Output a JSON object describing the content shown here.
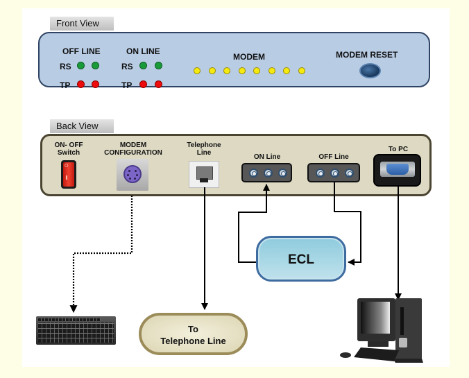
{
  "front_view": {
    "tab_label": "Front View",
    "off_line_label": "OFF LINE",
    "on_line_label": "ON LINE",
    "rs_label": "RS",
    "tp_label": "TP",
    "modem_label": "MODEM",
    "modem_led_count": 8,
    "modem_reset_label": "MODEM RESET",
    "colors": {
      "panel": "#b8cce4",
      "rs_led": "#1a9b3a",
      "tp_led": "#ee0b0b",
      "modem_led": "#f4ea10"
    }
  },
  "back_view": {
    "tab_label": "Back View",
    "switch_label": "ON- OFF\nSwitch",
    "modem_config_label": "MODEM\nCONFIGURATION",
    "telephone_line_label": "Telephone\nLine",
    "on_line_label": "ON Line",
    "off_line_label": "OFF Line",
    "to_pc_label": "To PC",
    "switch_marks": {
      "off": "O",
      "on": "I"
    },
    "colors": {
      "panel": "#ddd9c3"
    }
  },
  "nodes": {
    "ecl_label": "ECL",
    "telephone_terminal_label": "To\nTelephone Line",
    "keyboard": "keyboard-icon",
    "computer": "desktop-computer-icon"
  },
  "connections": [
    {
      "from": "MODEM CONFIGURATION",
      "to": "keyboard",
      "style": "dotted"
    },
    {
      "from": "Telephone Line",
      "to": "To Telephone Line",
      "style": "solid"
    },
    {
      "from": "ECL",
      "to": "ON Line",
      "style": "solid"
    },
    {
      "from": "OFF Line",
      "to": "ECL",
      "style": "solid"
    },
    {
      "from": "To PC",
      "to": "computer",
      "style": "solid"
    }
  ]
}
